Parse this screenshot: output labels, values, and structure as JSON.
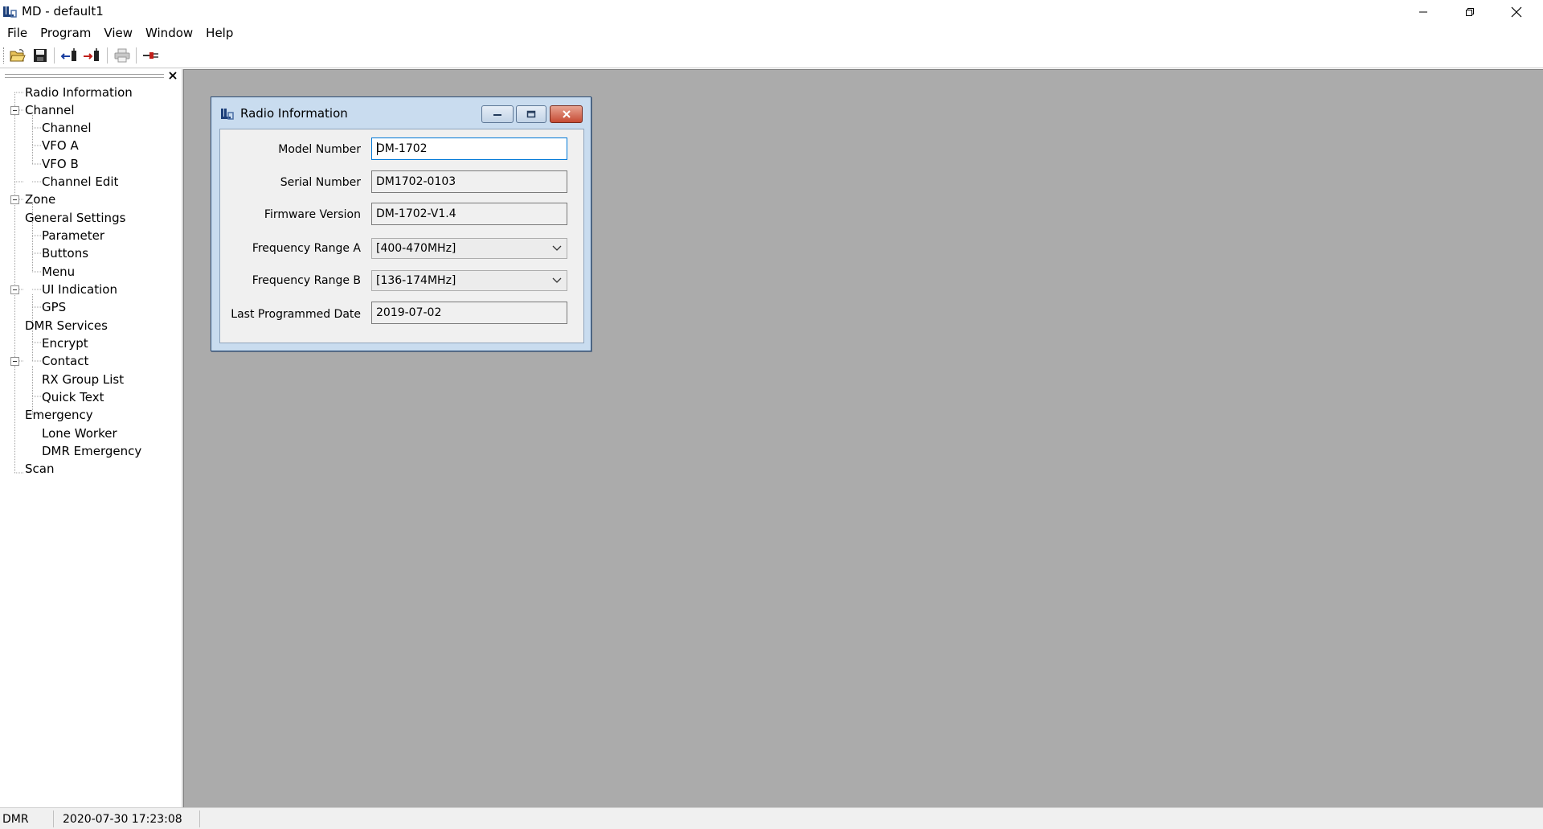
{
  "window": {
    "title": "MD - default1"
  },
  "menu": {
    "items": [
      "File",
      "Program",
      "View",
      "Window",
      "Help"
    ]
  },
  "toolbar": {
    "buttons": [
      {
        "icon": "open-folder-icon"
      },
      {
        "icon": "save-icon"
      },
      {
        "icon": "read-from-radio-icon"
      },
      {
        "icon": "write-to-radio-icon"
      },
      {
        "icon": "print-icon"
      },
      {
        "icon": "connect-icon"
      }
    ]
  },
  "tree": {
    "items": [
      {
        "label": "Radio Information",
        "level": 0
      },
      {
        "label": "Channel",
        "level": 0,
        "expanded": true
      },
      {
        "label": "Channel",
        "level": 1
      },
      {
        "label": "VFO A",
        "level": 1
      },
      {
        "label": "VFO B",
        "level": 1
      },
      {
        "label": "Channel Edit",
        "level": 1
      },
      {
        "label": "Zone",
        "level": 0
      },
      {
        "label": "General Settings",
        "level": 0,
        "expanded": true
      },
      {
        "label": "Parameter",
        "level": 1
      },
      {
        "label": "Buttons",
        "level": 1
      },
      {
        "label": "Menu",
        "level": 1
      },
      {
        "label": "UI Indication",
        "level": 1
      },
      {
        "label": "GPS",
        "level": 1
      },
      {
        "label": "DMR Services",
        "level": 0,
        "expanded": true
      },
      {
        "label": "Encrypt",
        "level": 1
      },
      {
        "label": "Contact",
        "level": 1
      },
      {
        "label": "RX Group List",
        "level": 1
      },
      {
        "label": "Quick Text",
        "level": 1
      },
      {
        "label": "Emergency",
        "level": 0,
        "expanded": true
      },
      {
        "label": "Lone Worker",
        "level": 1
      },
      {
        "label": "DMR Emergency",
        "level": 1
      },
      {
        "label": "Scan",
        "level": 0
      }
    ]
  },
  "radio_info": {
    "title": "Radio Information",
    "fields": [
      {
        "label": "Model Number",
        "value": "DM-1702",
        "kind": "text"
      },
      {
        "label": "Serial Number",
        "value": "DM1702-0103",
        "kind": "text"
      },
      {
        "label": "Firmware Version",
        "value": "DM-1702-V1.4",
        "kind": "text"
      },
      {
        "label": "Frequency Range A",
        "value": "[400-470MHz]",
        "kind": "select"
      },
      {
        "label": "Frequency Range B",
        "value": "[136-174MHz]",
        "kind": "select"
      },
      {
        "label": "Last Programmed Date",
        "value": "2019-07-02",
        "kind": "text"
      }
    ]
  },
  "status": {
    "mode": "DMR",
    "datetime": "2020-07-30 17:23:08"
  },
  "colors": {
    "mdi_background": "#ababab",
    "child_frame": "#c9dcef",
    "focus_border": "#0078d7",
    "close_button": "#c64b34"
  }
}
